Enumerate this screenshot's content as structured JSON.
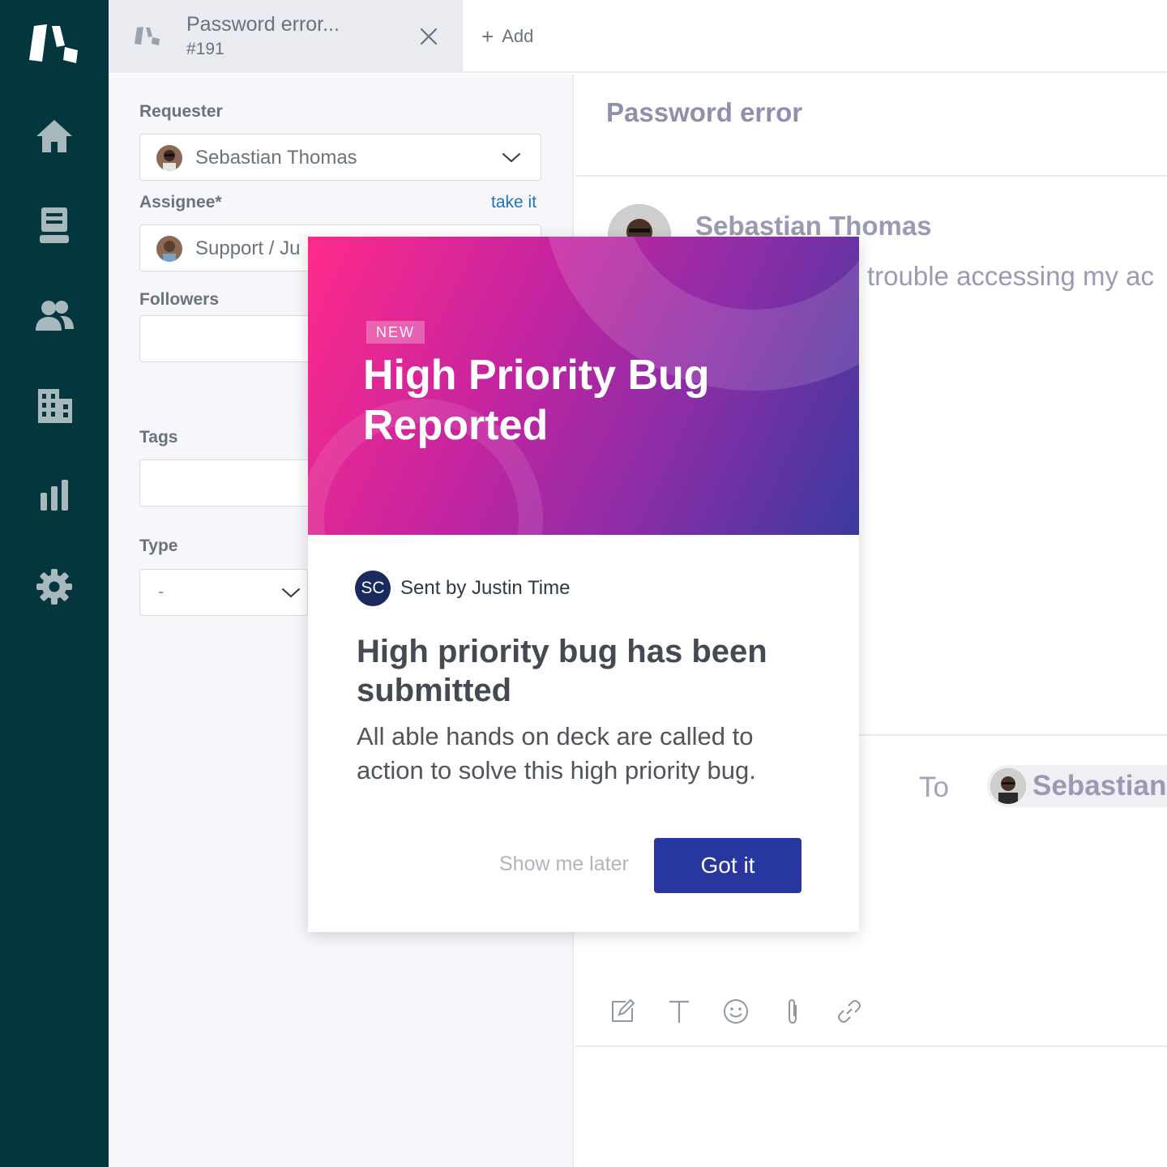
{
  "colors": {
    "sidebar_bg": "#03363d",
    "link": "#1f73b7",
    "primary_button": "#28379f",
    "hero_gradient_start": "#ff2a8a",
    "hero_gradient_end": "#3a3a9e"
  },
  "sidebar": {
    "items": [
      {
        "icon": "home-icon"
      },
      {
        "icon": "views-icon"
      },
      {
        "icon": "customers-icon"
      },
      {
        "icon": "organizations-icon"
      },
      {
        "icon": "reporting-icon"
      },
      {
        "icon": "admin-gear-icon"
      }
    ]
  },
  "tabbar": {
    "tab": {
      "title": "Password error...",
      "number": "#191"
    },
    "add_label": "Add"
  },
  "properties": {
    "requester_label": "Requester",
    "requester_value": "Sebastian Thomas",
    "assignee_label": "Assignee*",
    "take_it": "take it",
    "assignee_value": "Support / Ju",
    "followers_label": "Followers",
    "tags_label": "Tags",
    "type_label": "Type",
    "type_value": "-"
  },
  "conversation": {
    "subject": "Password error",
    "author": "Sebastian Thomas",
    "message": "trouble accessing my ac",
    "to_label": "To",
    "recipient": "Sebastian T"
  },
  "modal": {
    "badge": "NEW",
    "hero_title": "High Priority Bug Reported",
    "sender_initials": "SC",
    "sender_text": "Sent by Justin Time",
    "headline": "High priority bug has been submitted",
    "body": "All able hands on deck are called to action to solve this high priority bug.",
    "later_button": "Show me later",
    "primary_button": "Got it"
  }
}
